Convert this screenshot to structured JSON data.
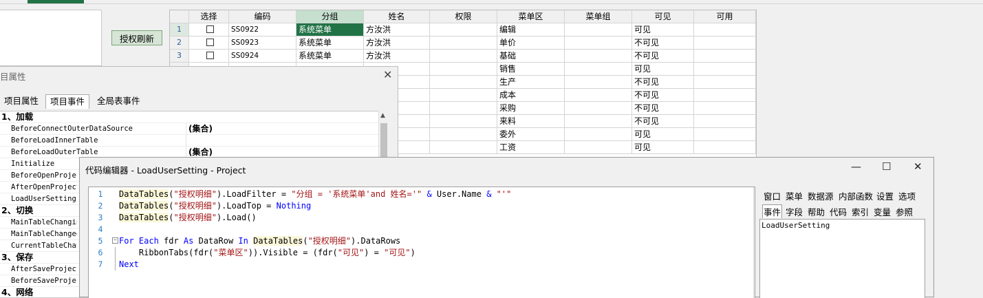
{
  "auth_refresh_button": "授权刷新",
  "grid": {
    "headers": [
      "",
      "选择",
      "编码",
      "分组",
      "姓名",
      "权限",
      "菜单区",
      "菜单组",
      "可见",
      "可用"
    ],
    "rows": [
      {
        "num": "1",
        "code": "SS0922",
        "group": "系统菜单",
        "name": "方汝洪",
        "area": "编辑",
        "visible": "可见"
      },
      {
        "num": "2",
        "code": "SS0923",
        "group": "系统菜单",
        "name": "方汝洪",
        "area": "单价",
        "visible": "不可见"
      },
      {
        "num": "3",
        "code": "SS0924",
        "group": "系统菜单",
        "name": "方汝洪",
        "area": "基础",
        "visible": "不可见"
      },
      {
        "num": "",
        "code": "",
        "group": "",
        "name": "",
        "area": "销售",
        "visible": "可见"
      },
      {
        "num": "",
        "code": "",
        "group": "",
        "name": "",
        "area": "生产",
        "visible": "不可见"
      },
      {
        "num": "",
        "code": "",
        "group": "",
        "name": "",
        "area": "成本",
        "visible": "不可见"
      },
      {
        "num": "",
        "code": "",
        "group": "",
        "name": "",
        "area": "采购",
        "visible": "不可见"
      },
      {
        "num": "",
        "code": "",
        "group": "",
        "name": "",
        "area": "来料",
        "visible": "不可见"
      },
      {
        "num": "",
        "code": "",
        "group": "",
        "name": "",
        "area": "委外",
        "visible": "可见"
      },
      {
        "num": "",
        "code": "",
        "group": "",
        "name": "",
        "area": "工资",
        "visible": "可见"
      }
    ]
  },
  "prop_window": {
    "title": "目属性",
    "tabs": [
      "项目属性",
      "项目事件",
      "全局表事件"
    ],
    "rows": [
      {
        "type": "cat",
        "name": "1、加载",
        "value": ""
      },
      {
        "type": "item",
        "name": "BeforeConnectOuterDataSource",
        "value": "(集合)"
      },
      {
        "type": "item",
        "name": "BeforeLoadInnerTable",
        "value": ""
      },
      {
        "type": "item",
        "name": "BeforeLoadOuterTable",
        "value": "(集合)"
      },
      {
        "type": "item",
        "name": "Initialize",
        "value": ""
      },
      {
        "type": "item",
        "name": "BeforeOpenProject",
        "value": ""
      },
      {
        "type": "item",
        "name": "AfterOpenProject",
        "value": ""
      },
      {
        "type": "item",
        "name": "LoadUserSetting",
        "value": ""
      },
      {
        "type": "cat",
        "name": "2、切换",
        "value": ""
      },
      {
        "type": "item",
        "name": "MainTableChanging",
        "value": ""
      },
      {
        "type": "item",
        "name": "MainTableChanged",
        "value": ""
      },
      {
        "type": "item",
        "name": "CurrentTableChanged",
        "value": ""
      },
      {
        "type": "cat",
        "name": "3、保存",
        "value": ""
      },
      {
        "type": "item",
        "name": "AfterSaveProject",
        "value": ""
      },
      {
        "type": "item",
        "name": "BeforeSaveProject",
        "value": ""
      },
      {
        "type": "cat",
        "name": "4、网络",
        "value": ""
      }
    ]
  },
  "code_editor": {
    "title": "代码编辑器 - LoadUserSetting - Project",
    "lines": [
      {
        "n": "1",
        "text": "DataTables(\"授权明细\").LoadFilter = \"分组 = '系统菜单'and 姓名='\" & User.Name & \"'\""
      },
      {
        "n": "2",
        "text": "DataTables(\"授权明细\").LoadTop = Nothing"
      },
      {
        "n": "3",
        "text": "DataTables(\"授权明细\").Load()"
      },
      {
        "n": "4",
        "text": ""
      },
      {
        "n": "5",
        "text": "For Each fdr As DataRow In DataTables(\"授权明细\").DataRows"
      },
      {
        "n": "6",
        "text": "    RibbonTabs(fdr(\"菜单区\")).Visible = (fdr(\"可见\") = \"可见\")"
      },
      {
        "n": "7",
        "text": "Next"
      }
    ],
    "menu_row1": [
      "窗口",
      "菜单",
      "数据源",
      "内部函数",
      "设置",
      "选项"
    ],
    "menu_row2": [
      "事件",
      "字段",
      "帮助",
      "代码",
      "索引",
      "变量",
      "参照"
    ],
    "side_item": "LoadUserSetting"
  }
}
